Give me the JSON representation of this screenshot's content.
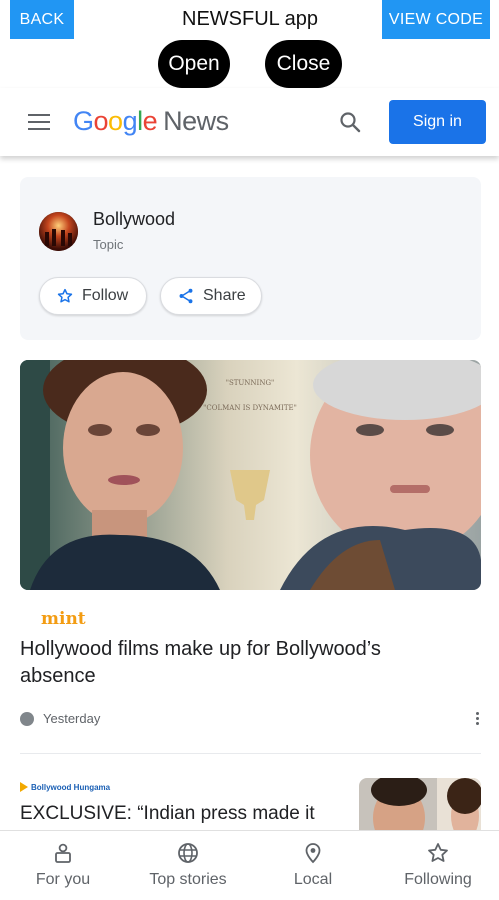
{
  "app_bar": {
    "back_label": "BACK",
    "title": "NEWSFUL app",
    "view_code_label": "VIEW CODE",
    "open_label": "Open",
    "close_label": "Close"
  },
  "header": {
    "logo_google": "Google",
    "logo_news": "News",
    "sign_in_label": "Sign in",
    "icons": [
      "menu-icon",
      "search-icon"
    ]
  },
  "topic": {
    "name": "Bollywood",
    "type": "Topic",
    "follow_label": "Follow",
    "share_label": "Share"
  },
  "articles": [
    {
      "source": "mint",
      "headline": "Hollywood films make up for Bollywood’s absence",
      "time": "Yesterday",
      "image_text": [
        "\"STUNNING\"",
        "\"COLMAN IS DYNAMITE\""
      ]
    },
    {
      "source": "Bollywood Hungama",
      "headline": "EXCLUSIVE: “Indian press made it"
    }
  ],
  "bottom_nav": {
    "items": [
      {
        "label": "For you",
        "icon": "for-you-icon"
      },
      {
        "label": "Top stories",
        "icon": "globe-icon"
      },
      {
        "label": "Local",
        "icon": "location-pin-icon"
      },
      {
        "label": "Following",
        "icon": "star-icon"
      }
    ]
  },
  "colors": {
    "accent_blue": "#1a73e8",
    "app_button_blue": "#2196f3",
    "mint_orange": "#f39c12"
  }
}
